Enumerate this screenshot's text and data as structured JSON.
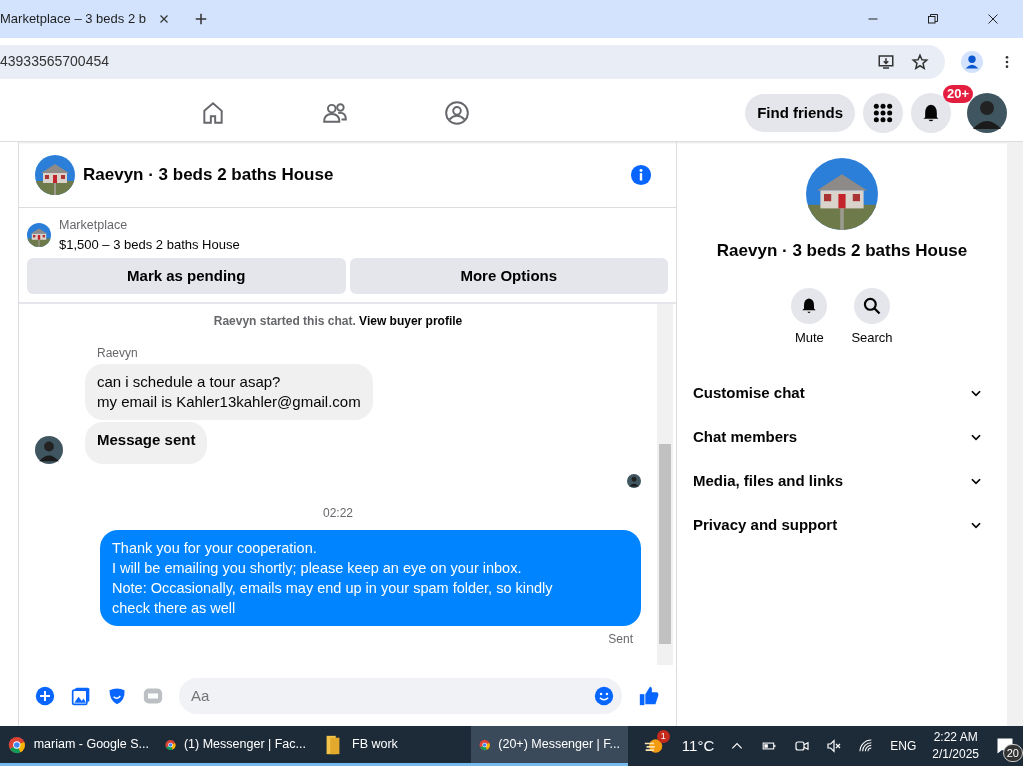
{
  "browser": {
    "tab_title": "Marketplace – 3 beds 2 b",
    "url": "43933565700454"
  },
  "nav": {
    "find_friends": "Find friends",
    "notification_badge": "20+"
  },
  "chat": {
    "title": "Raevyn · 3 beds 2 baths House",
    "listing": {
      "label": "Marketplace",
      "title": "$1,500 – 3 beds 2 baths House"
    },
    "actions": [
      "Mark as pending",
      "More Options"
    ],
    "intro": {
      "text": "Raevyn started this chat.",
      "link": "View buyer profile"
    },
    "messages": [
      {
        "kind": "incoming",
        "sender": "Raevyn",
        "lines": [
          "can i schedule a tour asap?",
          "my email is Kahler13kahler@gmail.com"
        ],
        "bold": false,
        "avatar": false
      },
      {
        "kind": "incoming",
        "lines": [
          "Message sent"
        ],
        "bold": true,
        "avatar": true
      },
      {
        "kind": "seen"
      },
      {
        "kind": "time",
        "text": "02:22"
      },
      {
        "kind": "outgoing",
        "lines": [
          "Thank you for your cooperation.",
          "I will be emailing you shortly; please keep an eye on your inbox.",
          "Note: Occasionally, emails may end up in your spam folder, so kindly",
          "check there as well"
        ],
        "bold": false
      },
      {
        "kind": "status",
        "text": "Sent"
      }
    ],
    "composer": {
      "placeholder": "Aa"
    }
  },
  "info": {
    "title": "Raevyn · 3 beds 2 baths House",
    "actions": [
      {
        "kind": "mute",
        "label": "Mute"
      },
      {
        "kind": "search",
        "label": "Search"
      }
    ],
    "sections": [
      {
        "label": "Customise chat",
        "expanded": false
      },
      {
        "label": "Chat members",
        "expanded": false
      },
      {
        "label": "Media, files and links",
        "expanded": false
      },
      {
        "label": "Privacy and support",
        "expanded": false
      }
    ]
  },
  "taskbar": {
    "items": [
      {
        "kind": "chrome",
        "label": "mariam - Google S...",
        "selected": false
      },
      {
        "kind": "chrome",
        "label": "(1) Messenger | Fac...",
        "selected": false
      },
      {
        "kind": "folder",
        "label": "FB work",
        "selected": false
      },
      {
        "kind": "chrome",
        "label": "(20+) Messenger | F...",
        "selected": true
      }
    ],
    "weather_badge": "1",
    "temperature": "11°C",
    "language": "ENG",
    "time": "2:22 AM",
    "date": "2/1/2025",
    "notification_count": "20"
  }
}
